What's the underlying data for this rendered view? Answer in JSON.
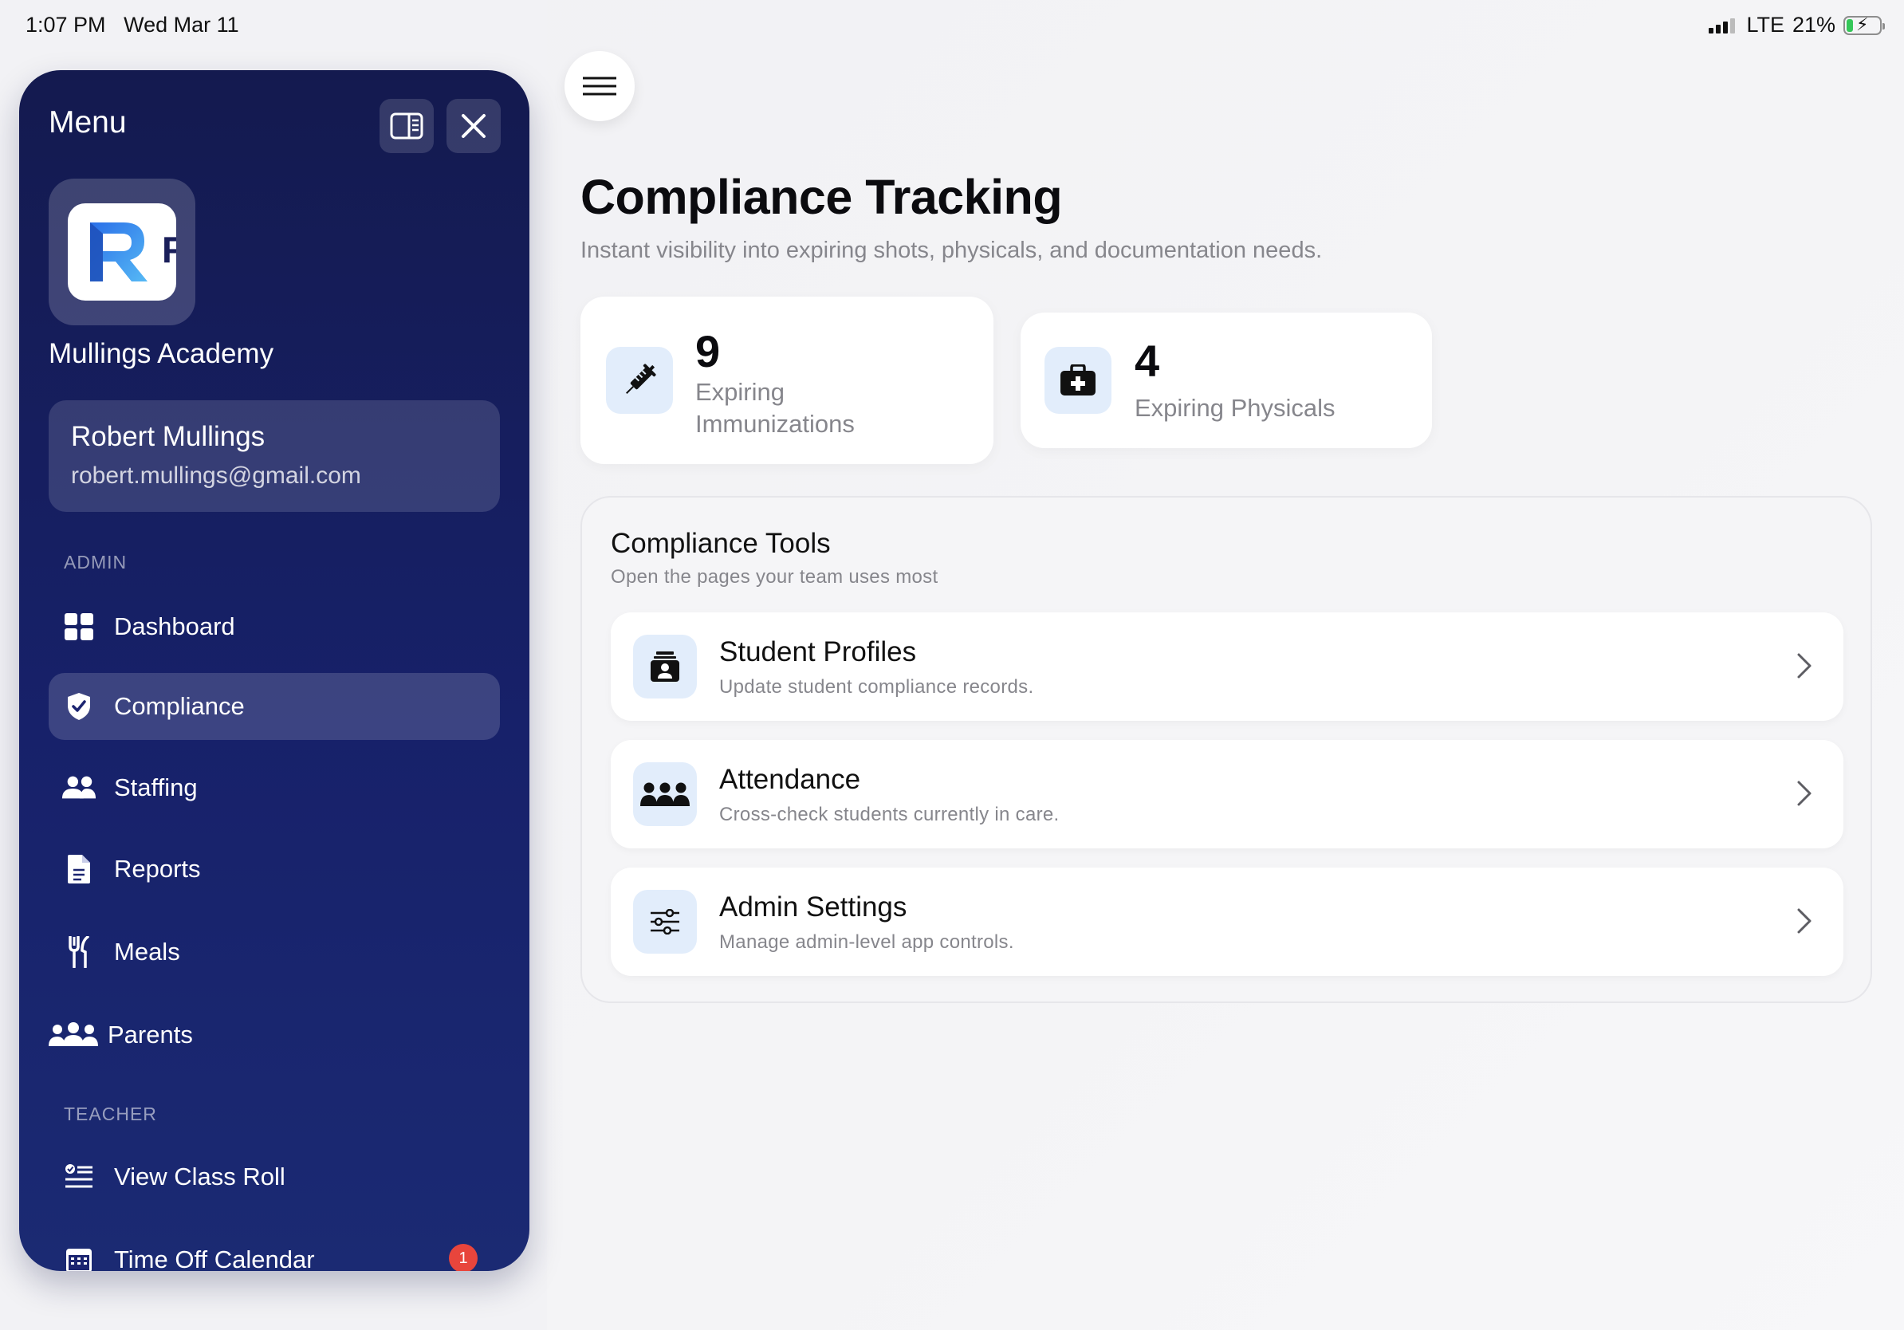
{
  "status_bar": {
    "time": "1:07 PM",
    "date": "Wed Mar 11",
    "network": "LTE",
    "battery": "21%",
    "battery_level": 0.21
  },
  "sidebar": {
    "title": "Menu",
    "school_name": "Mullings Academy",
    "user": {
      "name": "Robert Mullings",
      "email": "robert.mullings@gmail.com"
    },
    "sections": [
      {
        "label": "ADMIN",
        "items": [
          {
            "label": "Dashboard",
            "icon": "grid-icon",
            "active": false
          },
          {
            "label": "Compliance",
            "icon": "shield-check-icon",
            "active": true
          },
          {
            "label": "Staffing",
            "icon": "people-icon",
            "active": false
          },
          {
            "label": "Reports",
            "icon": "document-icon",
            "active": false
          },
          {
            "label": "Meals",
            "icon": "fork-knife-icon",
            "active": false
          },
          {
            "label": "Parents",
            "icon": "group-icon",
            "active": false
          }
        ]
      },
      {
        "label": "TEACHER",
        "items": [
          {
            "label": "View Class Roll",
            "icon": "checklist-icon",
            "active": false
          },
          {
            "label": "Time Off Calendar",
            "icon": "calendar-icon",
            "active": false,
            "badge": "1"
          }
        ]
      }
    ]
  },
  "main": {
    "title": "Compliance Tracking",
    "subtitle": "Instant visibility into expiring shots, physicals, and documentation needs.",
    "stats": [
      {
        "number": "9",
        "label": "Expiring Immunizations",
        "icon": "syringe-icon"
      },
      {
        "number": "4",
        "label": "Expiring Physicals",
        "icon": "medical-kit-icon"
      }
    ],
    "tools": {
      "title": "Compliance Tools",
      "subtitle": "Open the pages your team uses most",
      "items": [
        {
          "title": "Student Profiles",
          "description": "Update student compliance records.",
          "icon": "student-profile-icon"
        },
        {
          "title": "Attendance",
          "description": "Cross-check students currently in care.",
          "icon": "people-icon"
        },
        {
          "title": "Admin Settings",
          "description": "Manage admin-level app controls.",
          "icon": "sliders-icon"
        }
      ]
    }
  },
  "colors": {
    "sidebar_bg": "#17216a",
    "accent_icon_bg": "#e2edfb",
    "badge": "#e8453c",
    "battery": "#35c759"
  }
}
